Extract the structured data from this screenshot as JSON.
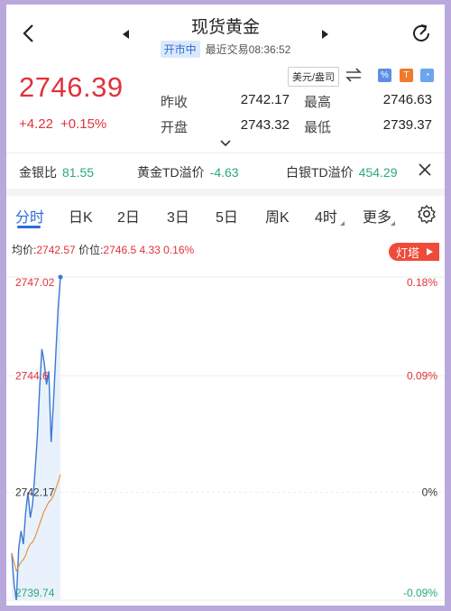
{
  "header": {
    "title": "现货黄金",
    "status": "开市中",
    "last_trade": "最近交易08:36:52"
  },
  "quote": {
    "price": "2746.39",
    "change": "+4.22",
    "change_pct": "+0.15%",
    "unit": "美元/盎司",
    "prev_close_label": "昨收",
    "prev_close": "2742.17",
    "open_label": "开盘",
    "open": "2743.32",
    "high_label": "最高",
    "high": "2746.63",
    "low_label": "最低",
    "low": "2739.37"
  },
  "ratios": {
    "gold_silver_label": "金银比",
    "gold_silver": "81.55",
    "gold_td_label": "黄金TD溢价",
    "gold_td": "-4.63",
    "silver_td_label": "白银TD溢价",
    "silver_td": "454.29"
  },
  "tabs": [
    "分时",
    "日K",
    "2日",
    "3日",
    "5日",
    "周K",
    "4时",
    "更多"
  ],
  "active_tab": "分时",
  "info_line": {
    "avg_label": "均价:",
    "avg": "2742.57",
    "price_label": "价位:",
    "price": "2746.5",
    "chg": "4.33",
    "pct": "0.16%"
  },
  "tower_button": "灯塔",
  "colors": {
    "up": "#e0323a",
    "down": "#2aa87a",
    "accent": "#2d6bd9",
    "price_line": "#3a78d6",
    "avg_line": "#e8953a"
  },
  "chart_data": {
    "type": "line",
    "y_ticks_left": [
      "2747.02",
      "2744.6",
      "2742.17",
      "2739.74"
    ],
    "y_ticks_right": [
      "0.18%",
      "0.09%",
      "0%",
      "-0.09%"
    ],
    "ylim": [
      2739.74,
      2747.02
    ],
    "prev_close": 2742.17,
    "series": [
      {
        "values": [
          2740.8,
          2740.1,
          2739.74,
          2740.9,
          2741.3,
          2741.0,
          2741.7,
          2742.17,
          2741.6,
          2741.9,
          2742.6,
          2743.4,
          2744.5,
          2745.4,
          2745.1,
          2744.6,
          2744.9,
          2743.3,
          2744.2,
          2745.3,
          2746.3,
          2747.02
        ]
      },
      {
        "values": [
          2740.8,
          2740.6,
          2740.4,
          2740.5,
          2740.6,
          2740.65,
          2740.75,
          2740.9,
          2741.0,
          2741.05,
          2741.15,
          2741.3,
          2741.45,
          2741.6,
          2741.75,
          2741.85,
          2741.95,
          2742.0,
          2742.1,
          2742.25,
          2742.4,
          2742.57
        ]
      }
    ]
  }
}
